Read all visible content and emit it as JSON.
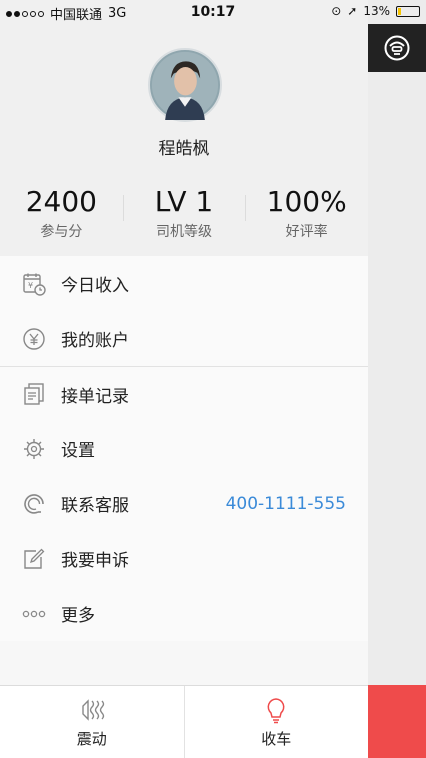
{
  "status_bar": {
    "carrier": "中国联通",
    "network": "3G",
    "time": "10:17",
    "battery_text": "13%",
    "battery_level": 0.13
  },
  "profile": {
    "name": "程皓枫",
    "stats": [
      {
        "value": "2400",
        "label": "参与分"
      },
      {
        "value": "LV 1",
        "label": "司机等级"
      },
      {
        "value": "100%",
        "label": "好评率"
      }
    ]
  },
  "menu": [
    {
      "icon": "calendar-income-icon",
      "label": "今日收入"
    },
    {
      "icon": "yen-circle-icon",
      "label": "我的账户"
    },
    {
      "icon": "documents-icon",
      "label": "接单记录"
    },
    {
      "icon": "gear-icon",
      "label": "设置"
    },
    {
      "icon": "headset-icon",
      "label": "联系客服",
      "extra": "400-1111-555"
    },
    {
      "icon": "edit-icon",
      "label": "我要申诉"
    },
    {
      "icon": "more-dots-icon",
      "label": "更多"
    }
  ],
  "bottom_bar": {
    "vibrate_label": "震动",
    "finish_label": "收车"
  },
  "colors": {
    "accent_blue": "#3a8ad8",
    "red": "#ef4b4b",
    "dark": "#222222"
  }
}
